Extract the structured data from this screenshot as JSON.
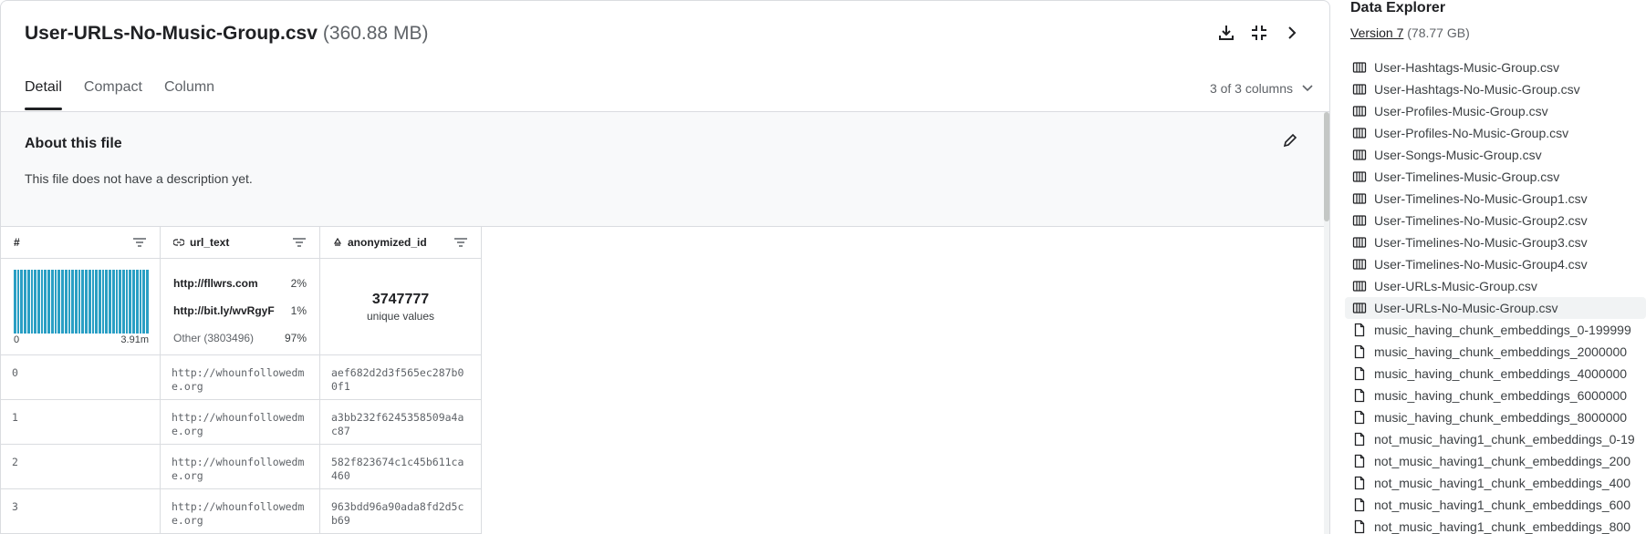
{
  "file": {
    "name": "User-URLs-No-Music-Group.csv",
    "size": "(360.88 MB)"
  },
  "header_icons": [
    "download-icon",
    "fullscreen-icon",
    "chevron-right-icon"
  ],
  "tabs": [
    {
      "label": "Detail",
      "active": true
    },
    {
      "label": "Compact",
      "active": false
    },
    {
      "label": "Column",
      "active": false
    }
  ],
  "column_count": "3 of 3 columns",
  "about": {
    "title": "About this file",
    "description": "This file does not have a description yet."
  },
  "table": {
    "columns": [
      {
        "name": "#",
        "type_icon": "hash-icon"
      },
      {
        "name": "url_text",
        "type_icon": "link-icon"
      },
      {
        "name": "anonymized_id",
        "type_icon": "id-icon"
      }
    ],
    "index_summary": {
      "min": "0",
      "max": "3.91m",
      "bar_color": "#2a9fc4"
    },
    "url_summary": [
      {
        "label": "http://fllwrs.com",
        "pct": "2%"
      },
      {
        "label": "http://bit.ly/wvRgyF",
        "pct": "1%"
      },
      {
        "label": "Other (3803496)",
        "pct": "97%"
      }
    ],
    "id_summary": {
      "count": "3747777",
      "label": "unique values"
    },
    "rows": [
      {
        "idx": "0",
        "url": "http://whounfollowedme.org",
        "id": "aef682d2d3f565ec287b00f1"
      },
      {
        "idx": "1",
        "url": "http://whounfollowedme.org",
        "id": "a3bb232f6245358509a4ac87"
      },
      {
        "idx": "2",
        "url": "http://whounfollowedme.org",
        "id": "582f823674c1c45b611ca460"
      },
      {
        "idx": "3",
        "url": "http://whounfollowedme.org",
        "id": "963bdd96a90ada8fd2d5cb69"
      }
    ]
  },
  "sidebar": {
    "title": "Data Explorer",
    "version_link": "Version 7",
    "version_size": "(78.77 GB)",
    "items": [
      {
        "label": "User-Hashtags-Music-Group.csv",
        "icon": "table-icon",
        "selected": false
      },
      {
        "label": "User-Hashtags-No-Music-Group.csv",
        "icon": "table-icon",
        "selected": false
      },
      {
        "label": "User-Profiles-Music-Group.csv",
        "icon": "table-icon",
        "selected": false
      },
      {
        "label": "User-Profiles-No-Music-Group.csv",
        "icon": "table-icon",
        "selected": false
      },
      {
        "label": "User-Songs-Music-Group.csv",
        "icon": "table-icon",
        "selected": false
      },
      {
        "label": "User-Timelines-Music-Group.csv",
        "icon": "table-icon",
        "selected": false
      },
      {
        "label": "User-Timelines-No-Music-Group1.csv",
        "icon": "table-icon",
        "selected": false
      },
      {
        "label": "User-Timelines-No-Music-Group2.csv",
        "icon": "table-icon",
        "selected": false
      },
      {
        "label": "User-Timelines-No-Music-Group3.csv",
        "icon": "table-icon",
        "selected": false
      },
      {
        "label": "User-Timelines-No-Music-Group4.csv",
        "icon": "table-icon",
        "selected": false
      },
      {
        "label": "User-URLs-Music-Group.csv",
        "icon": "table-icon",
        "selected": false
      },
      {
        "label": "User-URLs-No-Music-Group.csv",
        "icon": "table-icon",
        "selected": true
      },
      {
        "label": "music_having_chunk_embeddings_0-199999",
        "icon": "file-icon",
        "selected": false
      },
      {
        "label": "music_having_chunk_embeddings_2000000",
        "icon": "file-icon",
        "selected": false
      },
      {
        "label": "music_having_chunk_embeddings_4000000",
        "icon": "file-icon",
        "selected": false
      },
      {
        "label": "music_having_chunk_embeddings_6000000",
        "icon": "file-icon",
        "selected": false
      },
      {
        "label": "music_having_chunk_embeddings_8000000",
        "icon": "file-icon",
        "selected": false
      },
      {
        "label": "not_music_having1_chunk_embeddings_0-19",
        "icon": "file-icon",
        "selected": false
      },
      {
        "label": "not_music_having1_chunk_embeddings_200",
        "icon": "file-icon",
        "selected": false
      },
      {
        "label": "not_music_having1_chunk_embeddings_400",
        "icon": "file-icon",
        "selected": false
      },
      {
        "label": "not_music_having1_chunk_embeddings_600",
        "icon": "file-icon",
        "selected": false
      },
      {
        "label": "not_music_having1_chunk_embeddings_800",
        "icon": "file-icon",
        "selected": false
      }
    ]
  }
}
